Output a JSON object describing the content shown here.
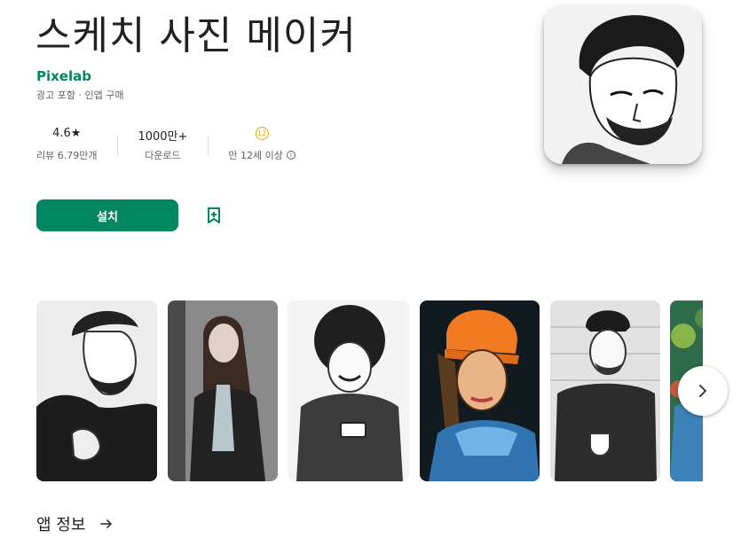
{
  "app": {
    "title": "스케치 사진 메이커",
    "developer": "Pixelab",
    "meta": "광고 포함 · 인앱 구매"
  },
  "stats": {
    "rating_value": "4.6★",
    "rating_label": "리뷰 6.79만개",
    "downloads_value": "1000만+",
    "downloads_label": "다운로드",
    "age_badge": "12",
    "age_label": "만 12세 이상"
  },
  "actions": {
    "install_label": "설치"
  },
  "section": {
    "about_label": "앱 정보"
  },
  "icons": {
    "star": "star-icon",
    "info": "info-icon",
    "wishlist": "bookmark-add-icon",
    "next": "chevron-right-icon",
    "about_arrow": "arrow-right-icon"
  },
  "colors": {
    "brand_green": "#01875f",
    "age_badge": "#e8a600",
    "text_primary": "#202124",
    "text_secondary": "#5f6368"
  }
}
